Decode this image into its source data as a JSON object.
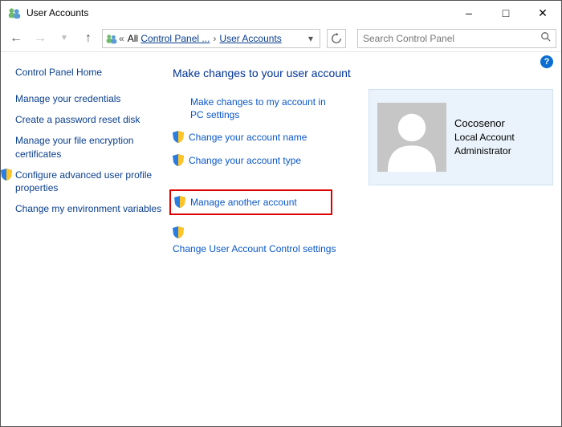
{
  "title": "User Accounts",
  "breadcrumb": {
    "prefix_separator": "«",
    "segment1_prefix": "All ",
    "segment1_link": "Control Panel ...",
    "segment2_link": "User Accounts"
  },
  "search": {
    "placeholder": "Search Control Panel"
  },
  "help": {
    "label": "?"
  },
  "sidebar": {
    "home": "Control Panel Home",
    "items": [
      {
        "label": "Manage your credentials",
        "shield": false
      },
      {
        "label": "Create a password reset disk",
        "shield": false
      },
      {
        "label": "Manage your file encryption certificates",
        "shield": false
      },
      {
        "label": "Configure advanced user profile properties",
        "shield": true
      },
      {
        "label": "Change my environment variables",
        "shield": false
      }
    ]
  },
  "main": {
    "heading": "Make changes to your user account",
    "links": [
      {
        "label": "Make changes to my account in PC settings",
        "shield": false,
        "multiline": true
      },
      {
        "label": "Change your account name",
        "shield": true
      },
      {
        "label": "Change your account type",
        "shield": true
      },
      {
        "label": "Manage another account",
        "shield": true,
        "highlighted": true
      },
      {
        "label": "Change User Account Control settings",
        "shield": true,
        "shield_above": true
      }
    ]
  },
  "account": {
    "name": "Cocosenor",
    "type": "Local Account",
    "role": "Administrator"
  }
}
